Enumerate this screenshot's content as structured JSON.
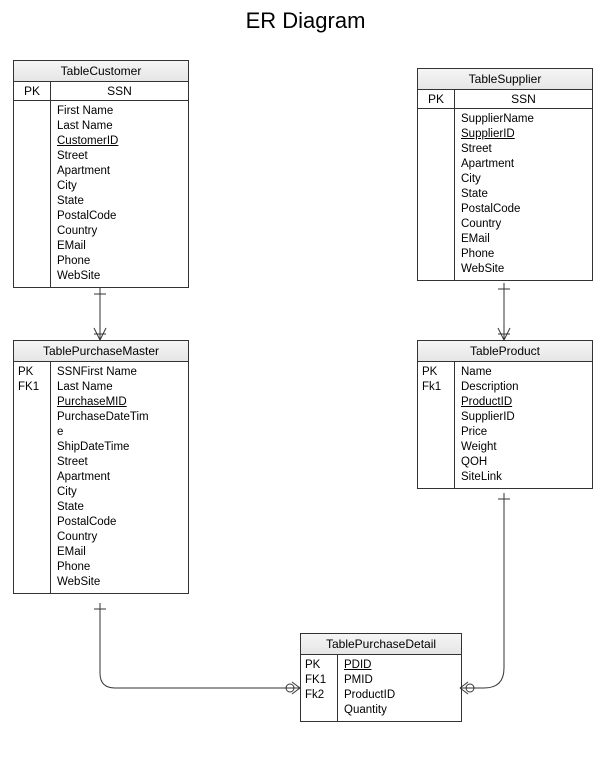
{
  "title": "ER Diagram",
  "entities": {
    "customer": {
      "name": "TableCustomer",
      "ssn": "SSN",
      "pk": "PK",
      "fields": [
        "First Name",
        "Last Name",
        "CustomerID",
        "Street",
        "Apartment",
        "City",
        "State",
        "PostalCode",
        "Country",
        "EMail",
        "Phone",
        "WebSite"
      ],
      "underlined": [
        "CustomerID"
      ]
    },
    "supplier": {
      "name": "TableSupplier",
      "ssn": "SSN",
      "pk": "PK",
      "fields": [
        "SupplierName",
        "SupplierID",
        "Street",
        "Apartment",
        "City",
        "State",
        "PostalCode",
        "Country",
        "EMail",
        "Phone",
        "WebSite"
      ],
      "underlined": [
        "SupplierID"
      ]
    },
    "purchaseMaster": {
      "name": "TablePurchaseMaster",
      "ssn": "",
      "keys": [
        "PK",
        "FK1"
      ],
      "fields": [
        "SSNFirst Name",
        "Last Name",
        "PurchaseMID",
        "PurchaseDateTime",
        "ShipDateTime",
        "Street",
        "Apartment",
        "City",
        "State",
        "PostalCode",
        "Country",
        "EMail",
        "Phone",
        "WebSite"
      ],
      "underlined": [
        "PurchaseMID"
      ]
    },
    "product": {
      "name": "TableProduct",
      "keys": [
        "PK",
        "Fk1"
      ],
      "fields": [
        "Name",
        "Description",
        "ProductID",
        "SupplierID",
        "Price",
        "Weight",
        "QOH",
        "SiteLink"
      ],
      "underlined": [
        "ProductID"
      ]
    },
    "purchaseDetail": {
      "name": "TablePurchaseDetail",
      "keys": [
        "PK",
        "FK1",
        "Fk2"
      ],
      "fields": [
        "PDID",
        "PMID",
        "ProductID",
        "Quantity"
      ],
      "underlined": [
        "PDID"
      ]
    }
  }
}
